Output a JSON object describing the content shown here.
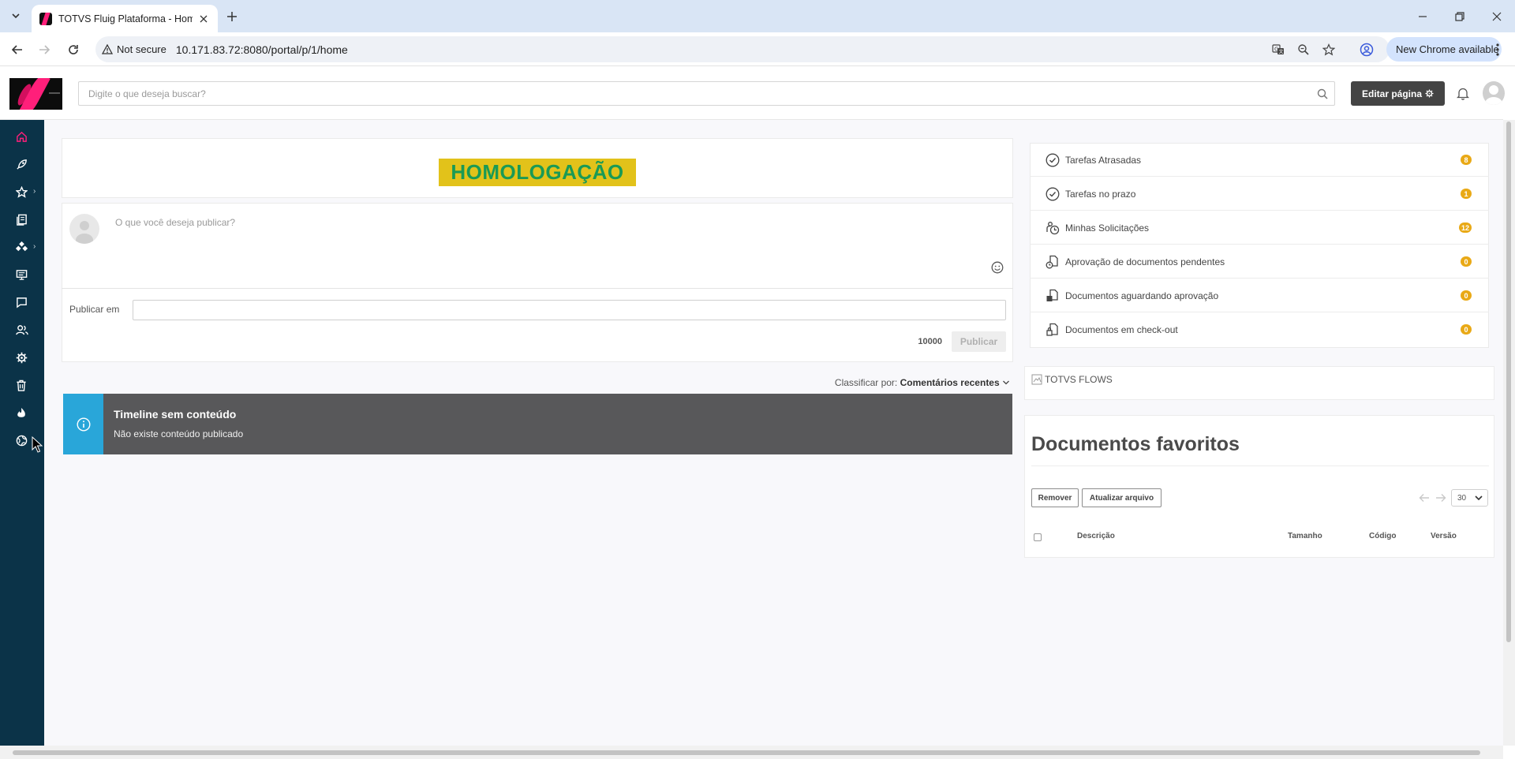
{
  "browser": {
    "tab_title": "TOTVS Fluig Plataforma - Home",
    "security_label": "Not secure",
    "url": "10.171.83.72:8080/portal/p/1/home",
    "new_chrome_label": "New Chrome available"
  },
  "header": {
    "search_placeholder": "Digite o que deseja buscar?",
    "edit_page_label": "Editar página"
  },
  "sidebar": {
    "items": [
      {
        "icon": "home-icon",
        "has_submenu": false,
        "active": true
      },
      {
        "icon": "rocket-icon",
        "has_submenu": false
      },
      {
        "icon": "star-icon",
        "has_submenu": true
      },
      {
        "icon": "documents-icon",
        "has_submenu": false
      },
      {
        "icon": "processes-icon",
        "has_submenu": true
      },
      {
        "icon": "presentation-icon",
        "has_submenu": false
      },
      {
        "icon": "chat-icon",
        "has_submenu": false
      },
      {
        "icon": "people-icon",
        "has_submenu": false
      },
      {
        "icon": "settings-icon",
        "has_submenu": false
      },
      {
        "icon": "trash-icon",
        "has_submenu": false
      },
      {
        "icon": "fire-icon",
        "has_submenu": false
      },
      {
        "icon": "globe-icon",
        "has_submenu": true
      }
    ]
  },
  "banner": {
    "text": "HOMOLOGAÇÃO"
  },
  "publish": {
    "placeholder": "O que você deseja publicar?",
    "publish_in_label": "Publicar em",
    "char_counter": "10000",
    "button_label": "Publicar"
  },
  "timeline": {
    "sort_label": "Classificar por:",
    "sort_value": "Comentários recentes",
    "empty_title": "Timeline sem conteúdo",
    "empty_message": "Não existe conteúdo publicado"
  },
  "tasks": [
    {
      "label": "Tarefas Atrasadas",
      "count": "8",
      "icon": "clock-check-icon"
    },
    {
      "label": "Tarefas no prazo",
      "count": "1",
      "icon": "clock-check-icon"
    },
    {
      "label": "Minhas Solicitações",
      "count": "12",
      "icon": "requests-icon"
    },
    {
      "label": "Aprovação de documentos pendentes",
      "count": "0",
      "icon": "document-pending-icon"
    },
    {
      "label": "Documentos aguardando aprovação",
      "count": "0",
      "icon": "document-waiting-icon"
    },
    {
      "label": "Documentos em check-out",
      "count": "0",
      "icon": "document-checkout-icon"
    }
  ],
  "flows": {
    "image_alt": "TOTVS FLOWS"
  },
  "favorites": {
    "title": "Documentos favoritos",
    "remove_label": "Remover",
    "update_label": "Atualizar arquivo",
    "per_page": "30",
    "columns": [
      "Descrição",
      "Tamanho",
      "Código",
      "Versão"
    ]
  },
  "colors": {
    "sidebar_bg": "#0b3348",
    "accent": "#ff1f7a",
    "badge": "#e9a916",
    "banner_bg": "#e2c21a",
    "banner_text": "#1a9a55",
    "info_strip": "#29a6d9"
  }
}
